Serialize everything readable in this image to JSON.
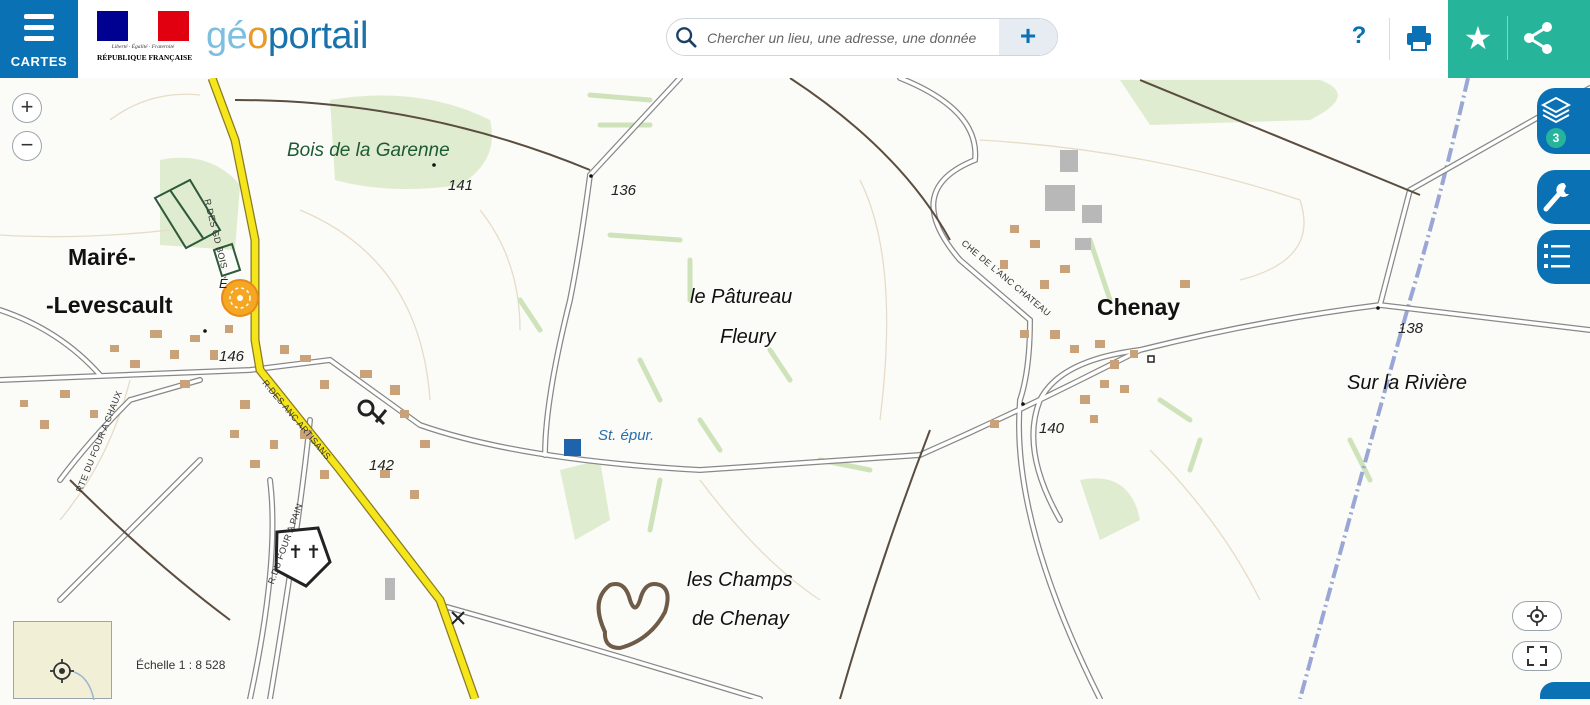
{
  "header": {
    "menu_label": "CARTES",
    "republic_motto": "Liberté · Égalité · Fraternité",
    "republic_name": "RÉPUBLIQUE FRANÇAISE",
    "brand_part1": "gé",
    "brand_part2": "o",
    "brand_part3": "portail",
    "search_placeholder": "Chercher un lieu, une adresse, une donnée",
    "help_label": "?",
    "add_label": "+"
  },
  "sidebar": {
    "layers_count": "3"
  },
  "map": {
    "scale_text": "Échelle 1 : 8 528",
    "places": [
      {
        "id": "maire1",
        "text": "Mairé-"
      },
      {
        "id": "maire2",
        "text": "-Levescault"
      },
      {
        "id": "chenay",
        "text": "Chenay"
      }
    ],
    "lieux_dits": [
      {
        "id": "pat1",
        "text": "le Pâtureau"
      },
      {
        "id": "pat2",
        "text": "Fleury"
      },
      {
        "id": "champs1",
        "text": "les Champs"
      },
      {
        "id": "champs2",
        "text": "de Chenay"
      },
      {
        "id": "riviere",
        "text": "Sur la Rivière"
      }
    ],
    "wood": "Bois de la Garenne",
    "water_label": "St. épur.",
    "altitudes": [
      "141",
      "136",
      "146",
      "142",
      "140",
      "138"
    ],
    "streets": [
      "R.DES GD BOIS",
      "R.DES ANC ARTISANS",
      "RTE DU FOUR A CHAUX",
      "R.DU FOUR A PAIN",
      "CHE DE L'ANC CHATEAU"
    ],
    "small_label": "É"
  },
  "colors": {
    "brand_blue": "#0a71b5",
    "teal": "#26b59a",
    "road_yellow": "#f5e51b",
    "forest": "#d7e8c8",
    "building": "#c9a27a"
  }
}
